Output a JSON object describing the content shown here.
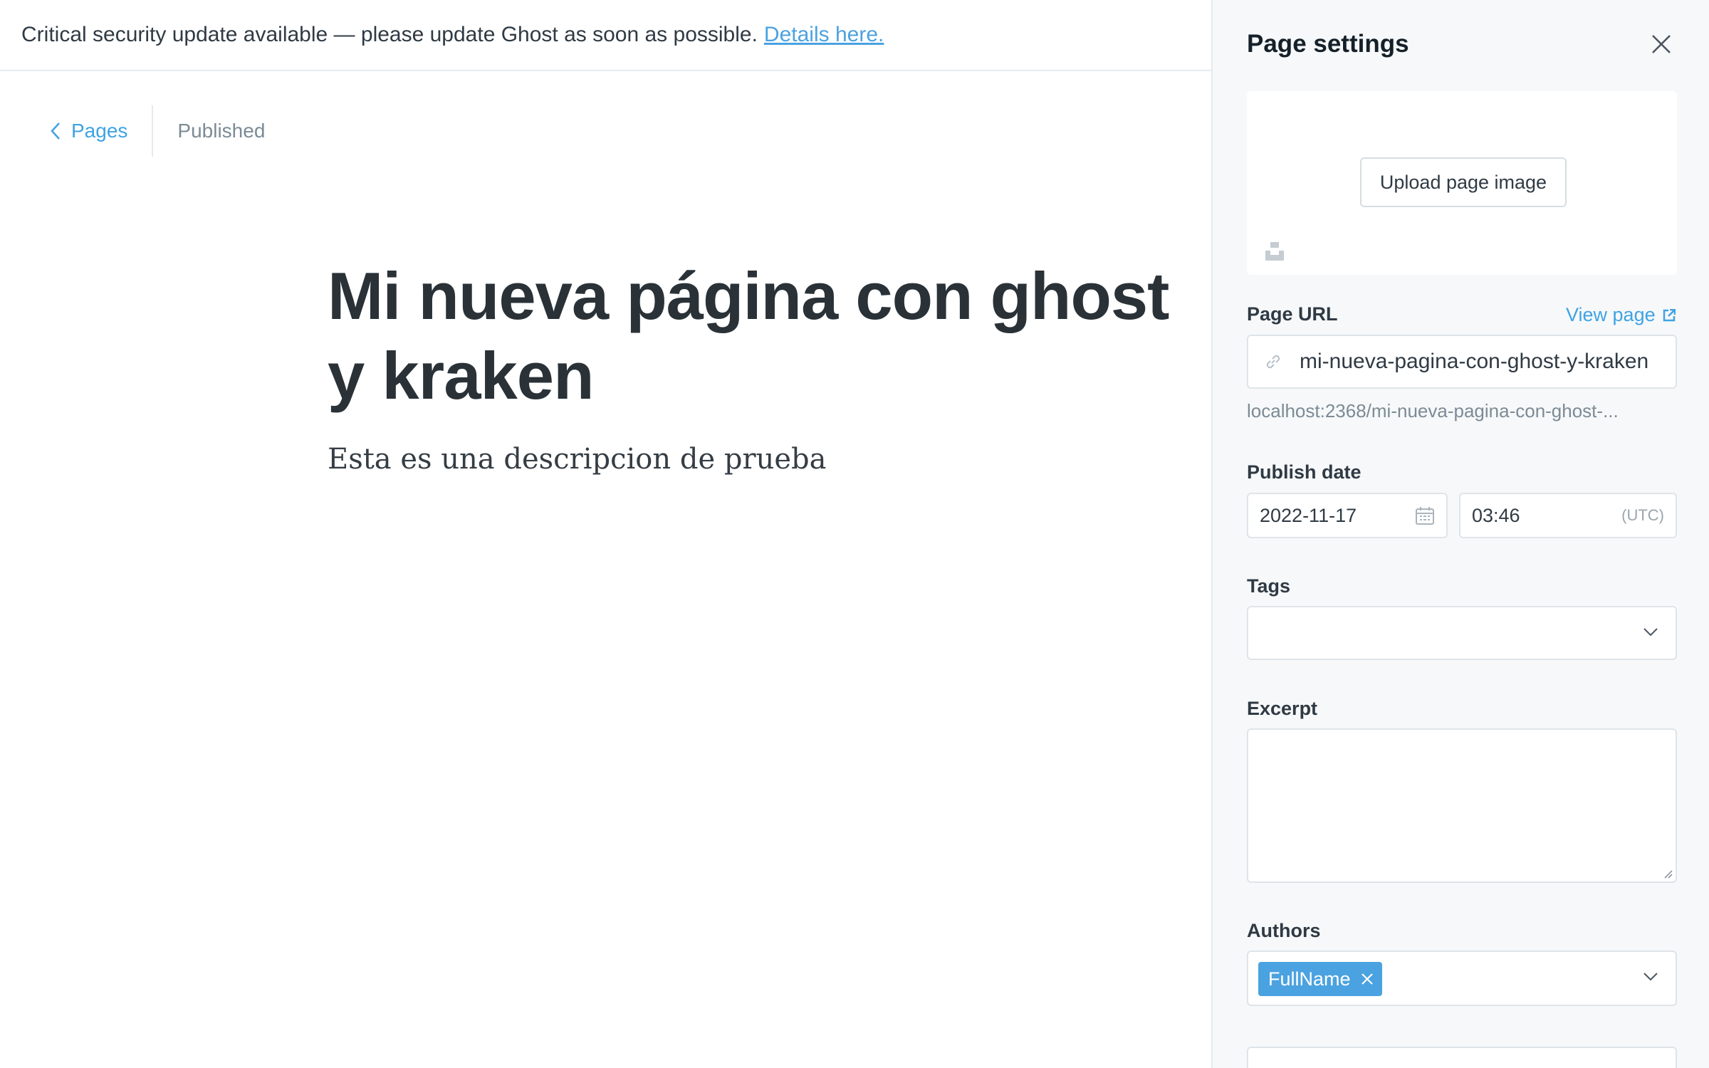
{
  "banner": {
    "message": "Critical security update available — please update Ghost as soon as possible.",
    "link_text": "Details here."
  },
  "editor": {
    "back_label": "Pages",
    "status": "Published",
    "title": "Mi nueva página con ghost y kraken",
    "excerpt": "Esta es una descripcion de prueba"
  },
  "settings": {
    "title": "Page settings",
    "upload_label": "Upload page image",
    "url_label": "Page URL",
    "view_page": "View page",
    "slug": "mi-nueva-pagina-con-ghost-y-kraken",
    "url_preview": "localhost:2368/mi-nueva-pagina-con-ghost-...",
    "publish_date_label": "Publish date",
    "date": "2022-11-17",
    "time": "03:46",
    "timezone": "(UTC)",
    "tags_label": "Tags",
    "excerpt_label": "Excerpt",
    "authors_label": "Authors",
    "authors": [
      "FullName"
    ]
  },
  "colors": {
    "accent": "#3fa3e3",
    "author_tag": "#4ba2e0",
    "panel_bg": "#f7f8f9"
  },
  "icons": [
    "chevron-left-icon",
    "close-icon",
    "unsplash-icon",
    "link-icon",
    "external-link-icon",
    "calendar-icon",
    "chevron-down-icon",
    "remove-author-icon",
    "resize-handle-icon"
  ]
}
